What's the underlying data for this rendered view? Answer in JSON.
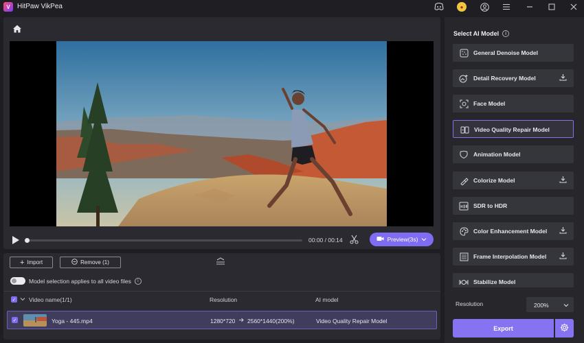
{
  "app": {
    "title": "HitPaw VikPea",
    "logo_letter": "V"
  },
  "titlebar": {
    "icons": [
      "discord-icon",
      "coin-icon",
      "user-icon",
      "menu-icon",
      "minimize-icon",
      "maximize-icon",
      "close-icon"
    ]
  },
  "preview": {
    "time": "00:00 / 00:14",
    "progress_fraction": 0,
    "preview_button": "Preview(3s)"
  },
  "file_panel": {
    "import_label": "Import",
    "remove_label": "Remove (1)",
    "toggle_label": "Model selection applies to all video files",
    "headers": {
      "name": "Video name(1/1)",
      "resolution": "Resolution",
      "model": "AI model"
    },
    "rows": [
      {
        "name": "Yoga - 445.mp4",
        "res_from": "1280*720",
        "res_to": "2560*1440(200%)",
        "model": "Video Quality Repair Model"
      }
    ]
  },
  "right_panel": {
    "title": "Select AI Model",
    "models": [
      {
        "label": "General Denoise Model",
        "icon": "denoise-icon",
        "download": false,
        "selected": false
      },
      {
        "label": "Detail Recovery Model",
        "icon": "detail-icon",
        "download": true,
        "selected": false
      },
      {
        "label": "Face Model",
        "icon": "face-icon",
        "download": false,
        "selected": false
      },
      {
        "label": "Video Quality Repair Model",
        "icon": "repair-icon",
        "download": false,
        "selected": true
      },
      {
        "label": "Animation Model",
        "icon": "animation-icon",
        "download": false,
        "selected": false
      },
      {
        "label": "Colorize Model",
        "icon": "colorize-icon",
        "download": true,
        "selected": false
      },
      {
        "label": "SDR to HDR",
        "icon": "hdr-icon",
        "download": false,
        "selected": false
      },
      {
        "label": "Color Enhancement Model",
        "icon": "palette-icon",
        "download": true,
        "selected": false
      },
      {
        "label": "Frame Interpolation Model",
        "icon": "frame-icon",
        "download": true,
        "selected": false
      },
      {
        "label": "Stabilize Model",
        "icon": "stabilize-icon",
        "download": false,
        "selected": false
      }
    ],
    "resolution_label": "Resolution",
    "resolution_value": "200%",
    "export_label": "Export"
  }
}
